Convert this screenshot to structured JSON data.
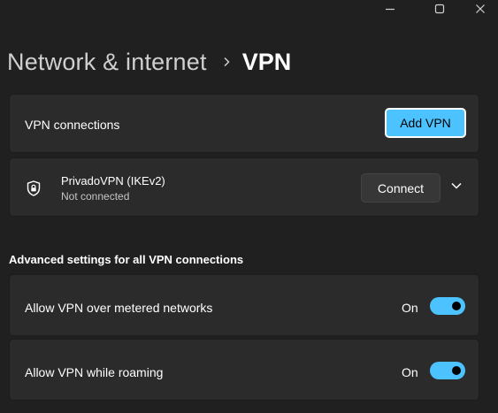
{
  "window": {
    "controls": [
      "minimize-icon",
      "maximize-icon",
      "close-icon"
    ]
  },
  "breadcrumb": {
    "parent": "Network & internet",
    "separator_icon": "chevron-right-icon",
    "current": "VPN"
  },
  "vpn_connections": {
    "label": "VPN connections",
    "add_button": "Add VPN"
  },
  "connection": {
    "icon": "shield-icon",
    "name": "PrivadoVPN (IKEv2)",
    "status": "Not connected",
    "connect_button": "Connect",
    "expand_icon": "chevron-down-icon"
  },
  "advanced": {
    "heading": "Advanced settings for all VPN connections",
    "settings": [
      {
        "label": "Allow VPN over metered networks",
        "state": "On",
        "enabled": true
      },
      {
        "label": "Allow VPN while roaming",
        "state": "On",
        "enabled": true
      }
    ]
  },
  "colors": {
    "background": "#202020",
    "card": "#2b2b2b",
    "accent": "#4cc2ff",
    "button": "#373737"
  }
}
